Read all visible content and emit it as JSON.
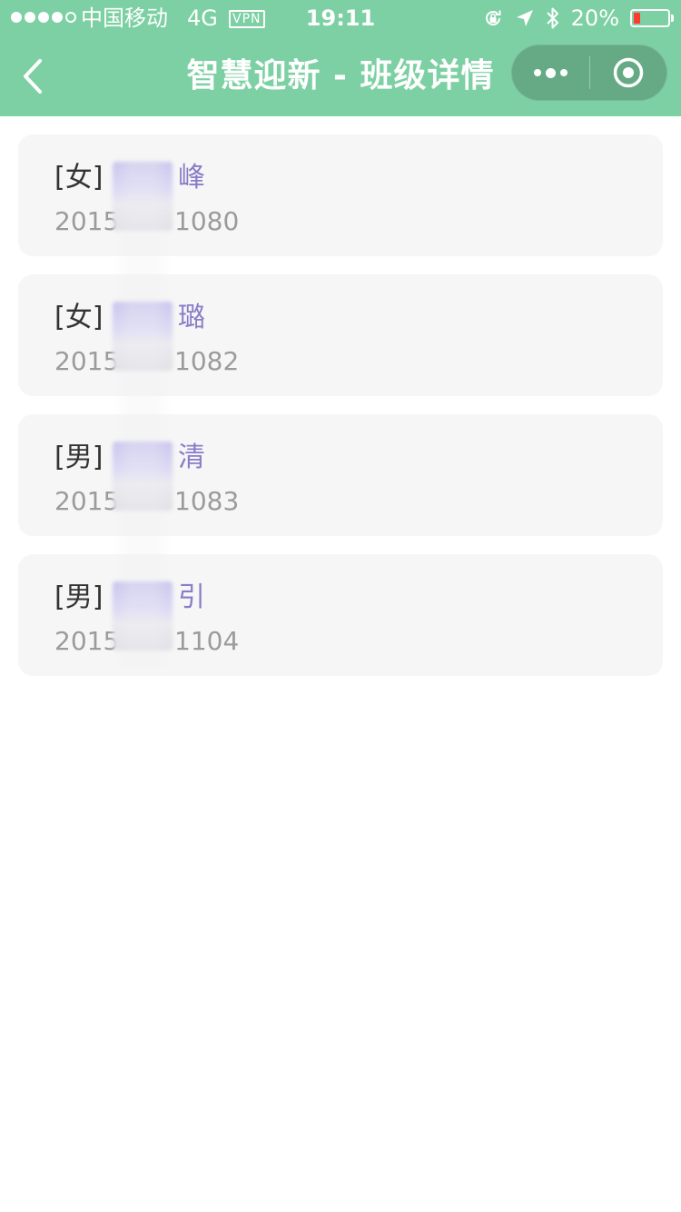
{
  "status_bar": {
    "carrier": "中国移动",
    "network": "4G",
    "vpn": "VPN",
    "time": "19:11",
    "battery_percent": "20%",
    "battery_level": 0.2,
    "battery_color": "#ff3b30",
    "icons": [
      "signal-icon",
      "orientation-lock-icon",
      "location-arrow-icon",
      "bluetooth-icon",
      "battery-icon"
    ]
  },
  "nav": {
    "title": "智慧迎新 - 班级详情",
    "background": "#7dd0a3",
    "back_icon": "chevron-left-icon",
    "more_icon": "more-dots-icon",
    "close_icon": "target-icon"
  },
  "students": [
    {
      "gender": "[女]",
      "name": "峰",
      "id_prefix": "2015",
      "id_suffix": "1080"
    },
    {
      "gender": "[女]",
      "name": "璐",
      "id_prefix": "2015",
      "id_suffix": "1082"
    },
    {
      "gender": "[男]",
      "name": "清",
      "id_prefix": "2015",
      "id_suffix": "1083"
    },
    {
      "gender": "[男]",
      "name": "引",
      "id_prefix": "2015",
      "id_suffix": "1104"
    }
  ],
  "colors": {
    "name": "#8a7cc8",
    "id": "#9b9b9b",
    "gender": "#333333",
    "card_background": "#f6f6f6"
  }
}
